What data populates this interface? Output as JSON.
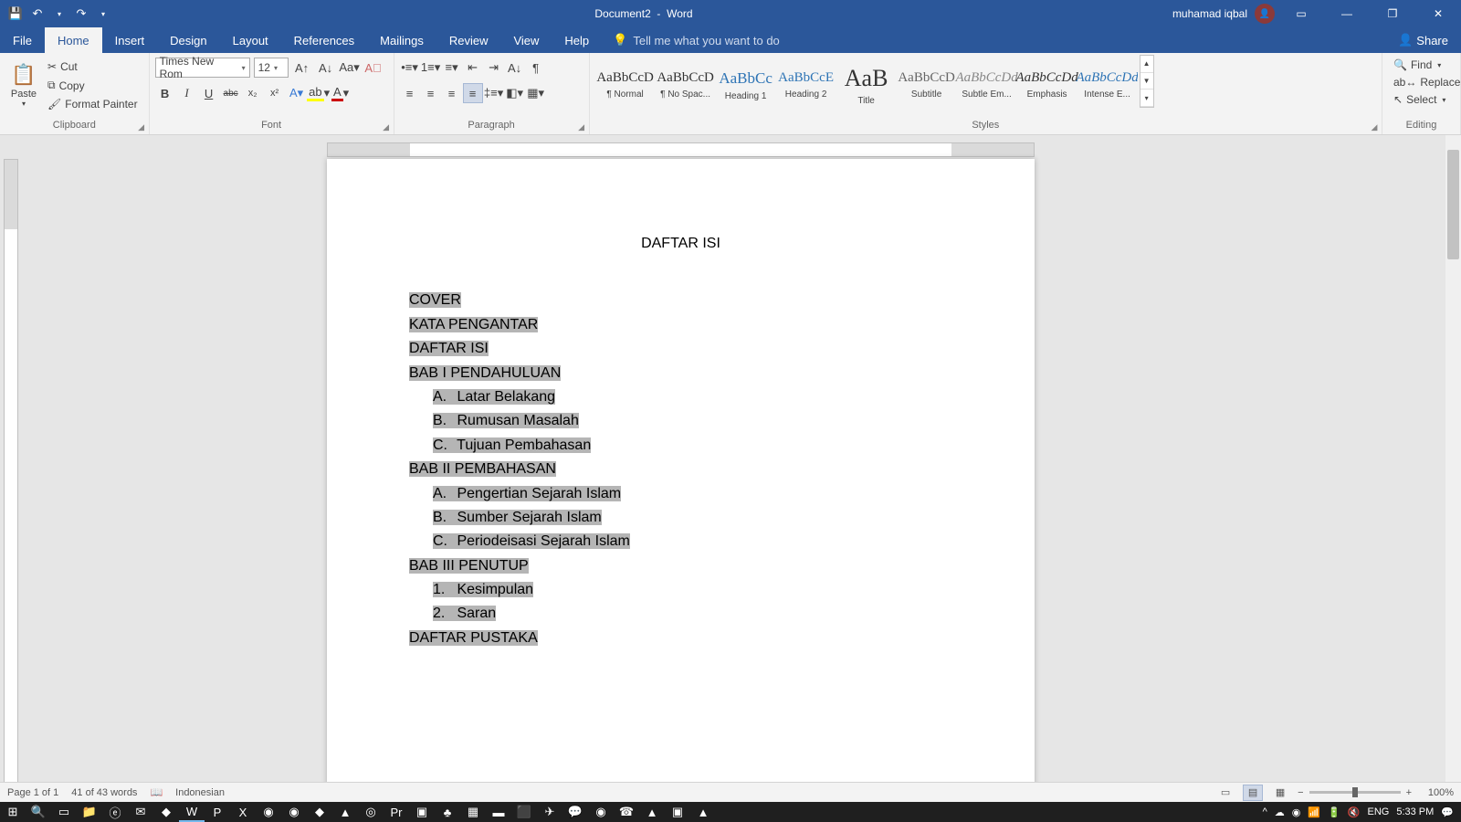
{
  "title": {
    "doc": "Document2",
    "app": "Word",
    "user": "muhamad iqbal"
  },
  "qat": {
    "save": "💾",
    "undo": "↶",
    "redo": "↷"
  },
  "tabs": [
    "File",
    "Home",
    "Insert",
    "Design",
    "Layout",
    "References",
    "Mailings",
    "Review",
    "View",
    "Help"
  ],
  "activeTab": "Home",
  "tell": "Tell me what you want to do",
  "share": "Share",
  "clipboard": {
    "paste": "Paste",
    "cut": "Cut",
    "copy": "Copy",
    "painter": "Format Painter",
    "label": "Clipboard"
  },
  "font": {
    "name": "Times New Rom",
    "size": "12",
    "label": "Font",
    "bold": "B",
    "italic": "I",
    "underline": "U",
    "strike": "abc",
    "sub": "x₂",
    "sup": "x²"
  },
  "paragraph": {
    "label": "Paragraph"
  },
  "styles": {
    "label": "Styles",
    "items": [
      {
        "prev": "AaBbCcD",
        "lbl": "¶ Normal",
        "cls": ""
      },
      {
        "prev": "AaBbCcD",
        "lbl": "¶ No Spac...",
        "cls": ""
      },
      {
        "prev": "AaBbCc",
        "lbl": "Heading 1",
        "cls": "h1"
      },
      {
        "prev": "AaBbCcE",
        "lbl": "Heading 2",
        "cls": "h2"
      },
      {
        "prev": "AaB",
        "lbl": "Title",
        "cls": "ttl"
      },
      {
        "prev": "AaBbCcD",
        "lbl": "Subtitle",
        "cls": "sub"
      },
      {
        "prev": "AaBbCcDd",
        "lbl": "Subtle Em...",
        "cls": "se"
      },
      {
        "prev": "AaBbCcDd",
        "lbl": "Emphasis",
        "cls": "em"
      },
      {
        "prev": "AaBbCcDd",
        "lbl": "Intense E...",
        "cls": "ie"
      }
    ]
  },
  "editing": {
    "find": "Find",
    "replace": "Replace",
    "select": "Select",
    "label": "Editing"
  },
  "document": {
    "title": "DAFTAR ISI",
    "lines": [
      {
        "t": "COVER",
        "lvl": 0
      },
      {
        "t": "KATA PENGANTAR",
        "lvl": 0
      },
      {
        "t": "DAFTAR ISI",
        "lvl": 0
      },
      {
        "t": "BAB I PENDAHULUAN",
        "lvl": 0
      },
      {
        "n": "A.",
        "t": "Latar Belakang",
        "lvl": 1
      },
      {
        "n": "B.",
        "t": "Rumusan Masalah",
        "lvl": 1
      },
      {
        "n": "C.",
        "t": "Tujuan Pembahasan",
        "lvl": 1
      },
      {
        "t": "BAB II PEMBAHASAN",
        "lvl": 0
      },
      {
        "n": "A.",
        "t": "Pengertian Sejarah Islam",
        "lvl": 1
      },
      {
        "n": "B.",
        "t": "Sumber Sejarah Islam",
        "lvl": 1
      },
      {
        "n": "C.",
        "t": "Periodeisasi Sejarah Islam",
        "lvl": 1
      },
      {
        "t": "BAB III PENUTUP",
        "lvl": 0
      },
      {
        "n": "1.",
        "t": "Kesimpulan",
        "lvl": 1
      },
      {
        "n": "2.",
        "t": "Saran",
        "lvl": 1
      },
      {
        "t": "DAFTAR PUSTAKA",
        "lvl": 0
      }
    ]
  },
  "status": {
    "page": "Page 1 of 1",
    "words": "41 of 43 words",
    "lang": "Indonesian",
    "zoom": "100%"
  },
  "tray": {
    "lang": "ENG",
    "time": "5:33 PM"
  }
}
